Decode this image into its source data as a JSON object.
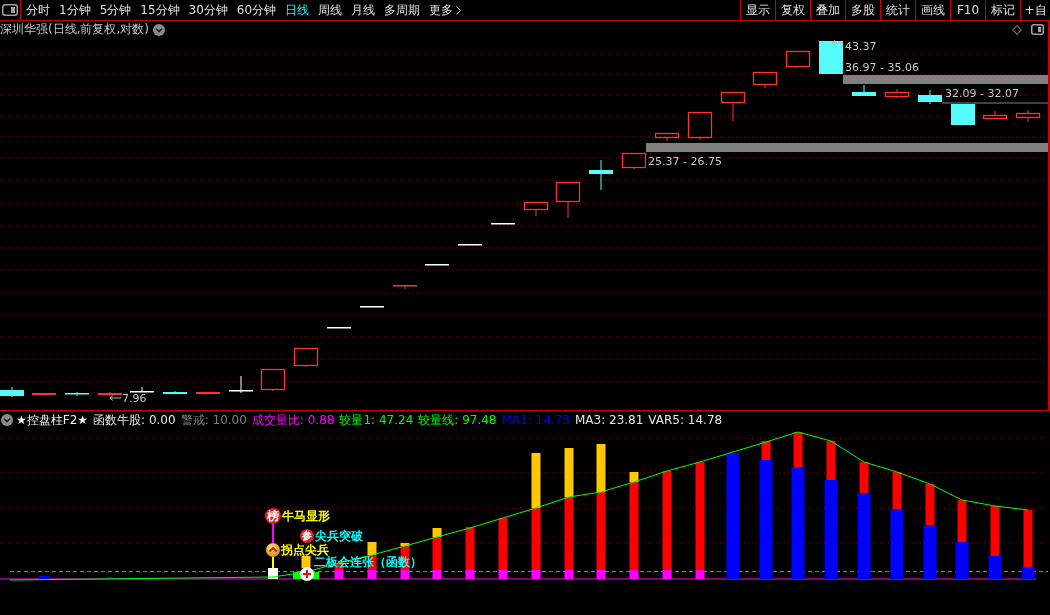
{
  "toolbar": {
    "period_tabs": [
      {
        "label": "分时",
        "selected": false
      },
      {
        "label": "1分钟",
        "selected": false
      },
      {
        "label": "5分钟",
        "selected": false
      },
      {
        "label": "15分钟",
        "selected": false
      },
      {
        "label": "30分钟",
        "selected": false
      },
      {
        "label": "60分钟",
        "selected": false
      },
      {
        "label": "日线",
        "selected": true
      },
      {
        "label": "周线",
        "selected": false
      },
      {
        "label": "月线",
        "selected": false
      },
      {
        "label": "多周期",
        "selected": false
      }
    ],
    "more_button": "更多",
    "tools": [
      "显示",
      "复权",
      "叠加",
      "多股",
      "统计",
      "画线",
      "F10",
      "标记",
      "+自"
    ]
  },
  "price_chart": {
    "title": "深圳华强(日线,前复权,对数)",
    "markers": [
      {
        "kind": "high",
        "label": "43.37"
      },
      {
        "kind": "low",
        "label": "7.96"
      }
    ],
    "zones": [
      {
        "label": "36.97 - 35.06"
      },
      {
        "label": "32.09 - 32.07"
      },
      {
        "label": "25.37 - 26.75"
      }
    ]
  },
  "indicator_panel": {
    "title": "★控盘柱F2★",
    "legend": [
      {
        "label": "函数牛股: 0.00",
        "color": "#e6e6e6"
      },
      {
        "label": "警戒: 10.00",
        "color": "#808080"
      },
      {
        "label": "成交量比: 0.88",
        "color": "#ff00ff"
      },
      {
        "label": "较量1: 47.24",
        "color": "#00ff00"
      },
      {
        "label": "较量线: 97.48",
        "color": "#00ff00"
      },
      {
        "label": "MA1: 14.73",
        "color": "#0000ff"
      },
      {
        "label": "MA3: 23.81",
        "color": "#e6e6e6"
      },
      {
        "label": "VAR5: 14.78",
        "color": "#e6e6e6"
      }
    ],
    "signals": [
      {
        "kind": "badge",
        "badge": "榜",
        "label": "牛马显形",
        "color": "#ffff00"
      },
      {
        "kind": "badge",
        "badge": "参",
        "label": "尖兵突破",
        "color": "#00ffff"
      },
      {
        "kind": "chevron",
        "label": "拐点尖兵",
        "color": "#ffff00"
      },
      {
        "kind": "plain",
        "label": "二板会连张（函数）",
        "color": "#00ffff"
      }
    ]
  }
}
